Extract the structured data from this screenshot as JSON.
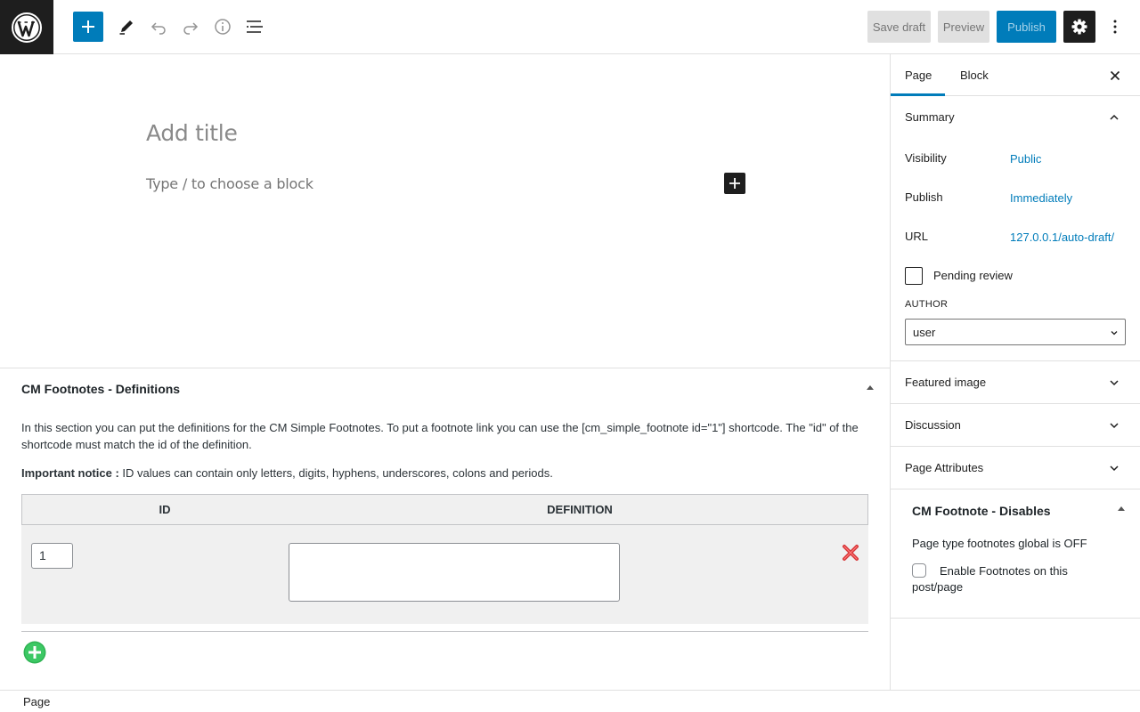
{
  "toolbar": {
    "logo_icon": "wordpress-logo-icon",
    "save_draft_label": "Save draft",
    "preview_label": "Preview",
    "publish_label": "Publish",
    "accent_color": "#007cba"
  },
  "editor": {
    "title_placeholder": "Add title",
    "block_placeholder": "Type / to choose a block"
  },
  "metabox": {
    "title": "CM Footnotes - Definitions",
    "description": "In this section you can put the definitions for the CM Simple Footnotes. To put a footnote link you can use the [cm_simple_footnote id=\"1\"] shortcode. The \"id\" of the shortcode must match the id of the definition.",
    "notice_label": "Important notice :",
    "notice_text": " ID values can contain only letters, digits, hyphens, underscores, colons and periods.",
    "table": {
      "columns": [
        "ID",
        "DEFINITION"
      ],
      "rows": [
        {
          "id": "1",
          "definition": ""
        }
      ]
    }
  },
  "footer": {
    "breadcrumb": "Page"
  },
  "sidebar": {
    "tabs": [
      {
        "label": "Page",
        "active": true
      },
      {
        "label": "Block",
        "active": false
      }
    ],
    "summary": {
      "title": "Summary",
      "visibility_label": "Visibility",
      "visibility_value": "Public",
      "publish_label": "Publish",
      "publish_value": "Immediately",
      "url_label": "URL",
      "url_value": "127.0.0.1/auto-draft/",
      "pending_review_label": "Pending review",
      "author_label": "AUTHOR",
      "author_value": "user"
    },
    "panels": [
      {
        "title": "Featured image"
      },
      {
        "title": "Discussion"
      },
      {
        "title": "Page Attributes"
      }
    ],
    "cm_disables": {
      "title": "CM Footnote - Disables",
      "status": "Page type footnotes global is OFF",
      "checkbox_label": "Enable Footnotes on this post/page"
    }
  }
}
